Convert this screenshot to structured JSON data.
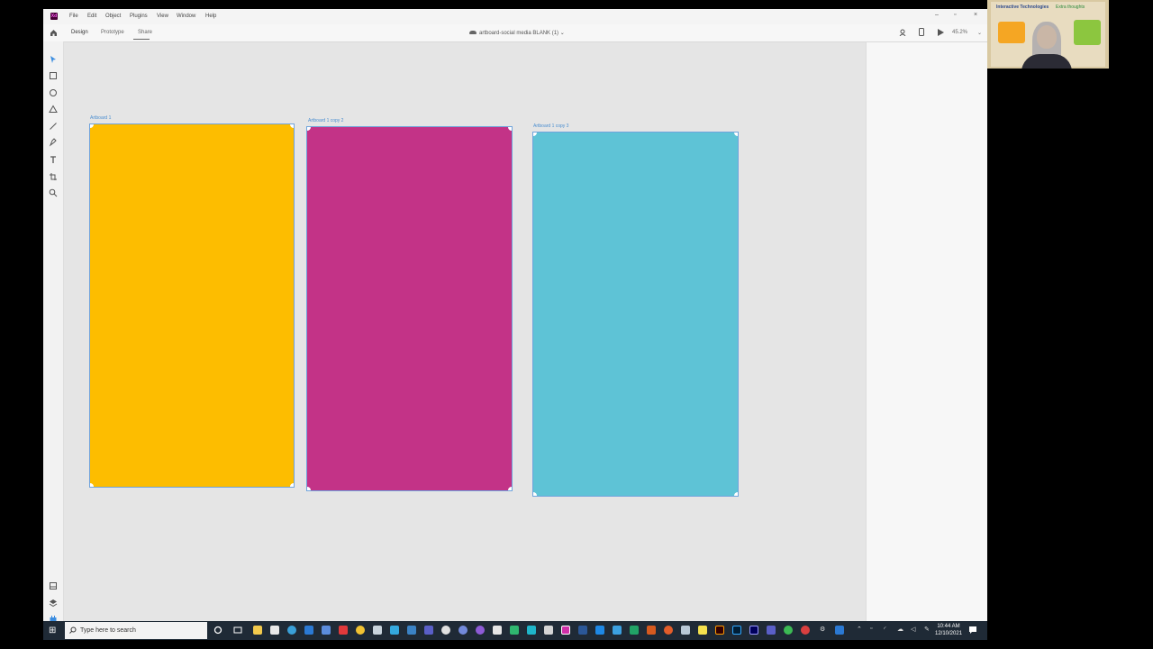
{
  "menubar": {
    "items": [
      "File",
      "Edit",
      "Object",
      "Plugins",
      "View",
      "Window",
      "Help"
    ],
    "app_icon": "Xd",
    "window_controls": {
      "minimize": "–",
      "maximize": "▫",
      "close": "×"
    }
  },
  "toolbar": {
    "tabs": [
      "Design",
      "Prototype",
      "Share"
    ],
    "doc_title": "artboard-social media BLANK (1)",
    "doc_title_chevron": "⌄",
    "zoom": "45.2%",
    "zoom_chevron": "⌄"
  },
  "artboards": [
    {
      "label": "Artboard 1",
      "color": "#fdbd00"
    },
    {
      "label": "Artboard 1 copy 2",
      "color": "#c33387"
    },
    {
      "label": "Artboard 1 copy 3",
      "color": "#5ec3d6"
    }
  ],
  "webcam": {
    "slide_title": "Interactive Technologies",
    "slide_sub": "Extra thoughts"
  },
  "taskbar": {
    "search_placeholder": "Type here to search",
    "time": "10:44 AM",
    "date": "12/10/2021"
  },
  "colors": {
    "accent": "#4b8ed0",
    "artboard_outline": "#6fa3dc",
    "taskbar_bg": "#1f2a36"
  }
}
